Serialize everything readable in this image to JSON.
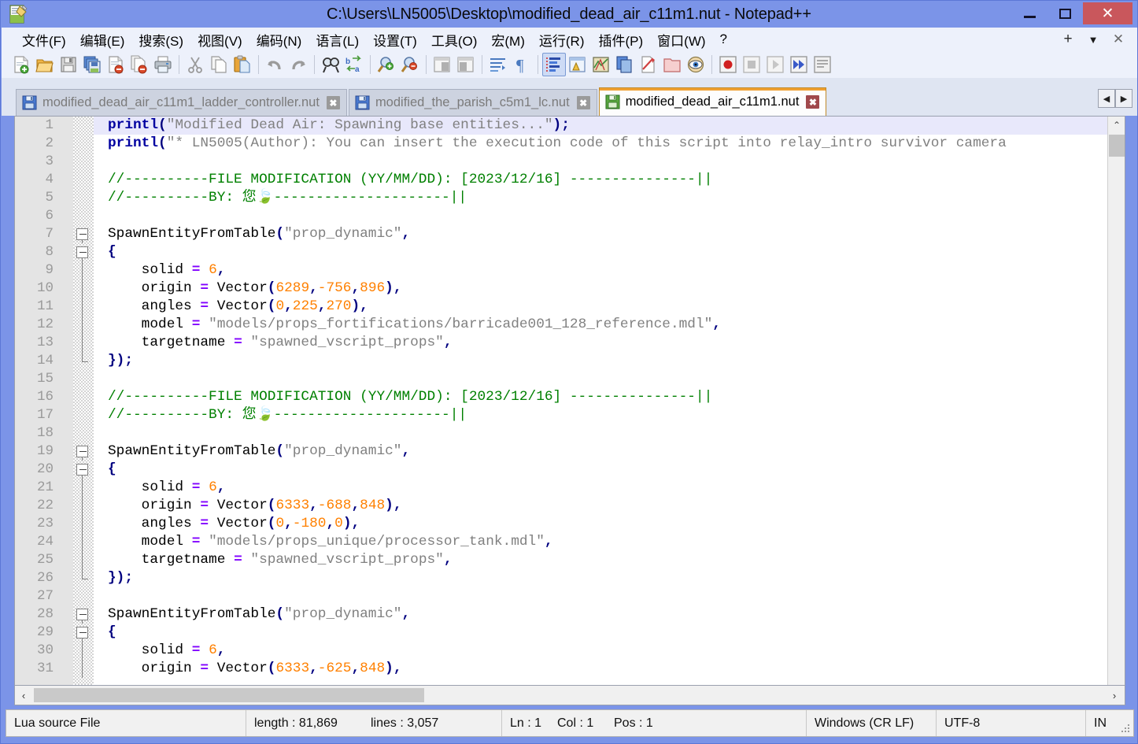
{
  "window": {
    "title": "C:\\Users\\LN5005\\Desktop\\modified_dead_air_c11m1.nut - Notepad++",
    "app_icon": "notepad-plus-plus-icon",
    "minimize_label": "–",
    "maximize_label": "□",
    "close_label": "✕",
    "titlebar_color": "#7b94e8",
    "close_button_color": "#c9575c"
  },
  "menubar": {
    "items": [
      {
        "label": "文件(F)",
        "mnemonic": "F"
      },
      {
        "label": "编辑(E)",
        "mnemonic": "E"
      },
      {
        "label": "搜索(S)",
        "mnemonic": "S"
      },
      {
        "label": "视图(V)",
        "mnemonic": "V"
      },
      {
        "label": "编码(N)",
        "mnemonic": "N"
      },
      {
        "label": "语言(L)",
        "mnemonic": "L"
      },
      {
        "label": "设置(T)",
        "mnemonic": "T"
      },
      {
        "label": "工具(O)",
        "mnemonic": "O"
      },
      {
        "label": "宏(M)",
        "mnemonic": "M"
      },
      {
        "label": "运行(R)",
        "mnemonic": "R"
      },
      {
        "label": "插件(P)",
        "mnemonic": "P"
      },
      {
        "label": "窗口(W)",
        "mnemonic": "W"
      },
      {
        "label": "?",
        "mnemonic": ""
      }
    ],
    "right_buttons": [
      {
        "name": "add-tab-button",
        "label": "+"
      },
      {
        "name": "menu-dropdown-button",
        "label": "▼"
      },
      {
        "name": "menu-close-button",
        "label": "✕"
      }
    ]
  },
  "toolbar": {
    "buttons": [
      {
        "name": "new-file-icon",
        "tip": "新建"
      },
      {
        "name": "open-file-icon",
        "tip": "打开"
      },
      {
        "name": "save-icon",
        "tip": "保存"
      },
      {
        "name": "save-all-icon",
        "tip": "全部保存"
      },
      {
        "name": "close-file-icon",
        "tip": "关闭"
      },
      {
        "name": "close-all-files-icon",
        "tip": "全部关闭"
      },
      {
        "name": "print-icon",
        "tip": "打印"
      },
      {
        "name": "sep"
      },
      {
        "name": "cut-icon",
        "tip": "剪切"
      },
      {
        "name": "copy-icon",
        "tip": "复制"
      },
      {
        "name": "paste-icon",
        "tip": "粘贴"
      },
      {
        "name": "sep"
      },
      {
        "name": "undo-icon",
        "tip": "撤销"
      },
      {
        "name": "redo-icon",
        "tip": "重做"
      },
      {
        "name": "sep"
      },
      {
        "name": "find-icon",
        "tip": "查找"
      },
      {
        "name": "replace-icon",
        "tip": "替换"
      },
      {
        "name": "sep"
      },
      {
        "name": "zoom-in-icon",
        "tip": "放大"
      },
      {
        "name": "zoom-out-icon",
        "tip": "缩小"
      },
      {
        "name": "sep"
      },
      {
        "name": "sync-vertical-scroll-icon",
        "tip": "同步垂直滚动"
      },
      {
        "name": "sync-horizontal-scroll-icon",
        "tip": "同步水平滚动"
      },
      {
        "name": "sep"
      },
      {
        "name": "word-wrap-icon",
        "tip": "自动换行"
      },
      {
        "name": "show-all-chars-icon",
        "tip": "显示所有字符"
      },
      {
        "name": "sep"
      },
      {
        "name": "indent-guide-icon",
        "tip": "显示缩进参考线",
        "active": true
      },
      {
        "name": "user-defined-dialog-icon",
        "tip": "用户自定义语言"
      },
      {
        "name": "document-map-icon",
        "tip": "文档地图"
      },
      {
        "name": "function-list-icon",
        "tip": "函数列表"
      },
      {
        "name": "document-switcher-icon",
        "tip": "文档列表"
      },
      {
        "name": "folder-workspace-icon",
        "tip": "文件夹作为工作区"
      },
      {
        "name": "monitor-icon",
        "tip": "监视文件"
      },
      {
        "name": "sep"
      },
      {
        "name": "record-macro-icon",
        "tip": "开始录制宏"
      },
      {
        "name": "stop-macro-icon",
        "tip": "停止录制宏"
      },
      {
        "name": "play-macro-icon",
        "tip": "播放宏"
      },
      {
        "name": "run-macro-multiple-icon",
        "tip": "多次运行宏"
      },
      {
        "name": "save-macro-icon",
        "tip": "保存当前录制的宏"
      }
    ]
  },
  "tabs": {
    "items": [
      {
        "label": "modified_dead_air_c11m1_ladder_controller.nut",
        "selected": false,
        "close": "✖"
      },
      {
        "label": "modified_the_parish_c5m1_lc.nut",
        "selected": false,
        "close": "✖"
      },
      {
        "label": "modified_dead_air_c11m1.nut",
        "selected": true,
        "close": "✖"
      }
    ],
    "scroll_left": "◀",
    "scroll_right": "▶",
    "active_tab_accent": "#f0a030"
  },
  "editor": {
    "lines": [
      {
        "n": "1",
        "current": true,
        "fold": "none",
        "tokens": [
          {
            "t": "fn",
            "v": "printl"
          },
          {
            "t": "punc",
            "v": "("
          },
          {
            "t": "str",
            "v": "\"Modified Dead Air: Spawning base entities...\""
          },
          {
            "t": "punc",
            "v": ")"
          },
          {
            "t": "punc",
            "v": ";"
          }
        ]
      },
      {
        "n": "2",
        "current": false,
        "fold": "none",
        "tokens": [
          {
            "t": "fn",
            "v": "printl"
          },
          {
            "t": "punc",
            "v": "("
          },
          {
            "t": "str",
            "v": "\"* LN5005(Author): You can insert the execution code of this script into relay_intro survivor camera"
          }
        ]
      },
      {
        "n": "3",
        "current": false,
        "fold": "none",
        "tokens": []
      },
      {
        "n": "4",
        "current": false,
        "fold": "none",
        "tokens": [
          {
            "t": "cmt",
            "v": "//----------FILE MODIFICATION (YY/MM/DD): [2023/12/16] ---------------||"
          }
        ]
      },
      {
        "n": "5",
        "current": false,
        "fold": "none",
        "tokens": [
          {
            "t": "cmt",
            "v": "//----------BY: 您🍃---------------------||"
          }
        ]
      },
      {
        "n": "6",
        "current": false,
        "fold": "none",
        "tokens": []
      },
      {
        "n": "7",
        "current": false,
        "fold": "start",
        "tokens": [
          {
            "t": "id",
            "v": "SpawnEntityFromTable"
          },
          {
            "t": "punc",
            "v": "("
          },
          {
            "t": "str",
            "v": "\"prop_dynamic\""
          },
          {
            "t": "punc",
            "v": ","
          }
        ]
      },
      {
        "n": "8",
        "current": false,
        "fold": "start",
        "tokens": [
          {
            "t": "punc",
            "v": "{"
          }
        ]
      },
      {
        "n": "9",
        "current": false,
        "fold": "line",
        "tokens": [
          {
            "t": "id",
            "v": "    solid "
          },
          {
            "t": "op",
            "v": "="
          },
          {
            "t": "id",
            "v": " "
          },
          {
            "t": "num",
            "v": "6"
          },
          {
            "t": "punc",
            "v": ","
          }
        ]
      },
      {
        "n": "10",
        "current": false,
        "fold": "line",
        "tokens": [
          {
            "t": "id",
            "v": "    origin "
          },
          {
            "t": "op",
            "v": "="
          },
          {
            "t": "id",
            "v": " Vector"
          },
          {
            "t": "punc",
            "v": "("
          },
          {
            "t": "num",
            "v": "6289"
          },
          {
            "t": "punc",
            "v": ","
          },
          {
            "t": "num",
            "v": "-756"
          },
          {
            "t": "punc",
            "v": ","
          },
          {
            "t": "num",
            "v": "896"
          },
          {
            "t": "punc",
            "v": ")"
          },
          {
            "t": "punc",
            "v": ","
          }
        ]
      },
      {
        "n": "11",
        "current": false,
        "fold": "line",
        "tokens": [
          {
            "t": "id",
            "v": "    angles "
          },
          {
            "t": "op",
            "v": "="
          },
          {
            "t": "id",
            "v": " Vector"
          },
          {
            "t": "punc",
            "v": "("
          },
          {
            "t": "num",
            "v": "0"
          },
          {
            "t": "punc",
            "v": ","
          },
          {
            "t": "num",
            "v": "225"
          },
          {
            "t": "punc",
            "v": ","
          },
          {
            "t": "num",
            "v": "270"
          },
          {
            "t": "punc",
            "v": ")"
          },
          {
            "t": "punc",
            "v": ","
          }
        ]
      },
      {
        "n": "12",
        "current": false,
        "fold": "line",
        "tokens": [
          {
            "t": "id",
            "v": "    model "
          },
          {
            "t": "op",
            "v": "="
          },
          {
            "t": "id",
            "v": " "
          },
          {
            "t": "str",
            "v": "\"models/props_fortifications/barricade001_128_reference.mdl\""
          },
          {
            "t": "punc",
            "v": ","
          }
        ]
      },
      {
        "n": "13",
        "current": false,
        "fold": "line",
        "tokens": [
          {
            "t": "id",
            "v": "    targetname "
          },
          {
            "t": "op",
            "v": "="
          },
          {
            "t": "id",
            "v": " "
          },
          {
            "t": "str",
            "v": "\"spawned_vscript_props\""
          },
          {
            "t": "punc",
            "v": ","
          }
        ]
      },
      {
        "n": "14",
        "current": false,
        "fold": "end",
        "tokens": [
          {
            "t": "punc",
            "v": "});"
          }
        ]
      },
      {
        "n": "15",
        "current": false,
        "fold": "none",
        "tokens": []
      },
      {
        "n": "16",
        "current": false,
        "fold": "none",
        "tokens": [
          {
            "t": "cmt",
            "v": "//----------FILE MODIFICATION (YY/MM/DD): [2023/12/16] ---------------||"
          }
        ]
      },
      {
        "n": "17",
        "current": false,
        "fold": "none",
        "tokens": [
          {
            "t": "cmt",
            "v": "//----------BY: 您🍃---------------------||"
          }
        ]
      },
      {
        "n": "18",
        "current": false,
        "fold": "none",
        "tokens": []
      },
      {
        "n": "19",
        "current": false,
        "fold": "start",
        "tokens": [
          {
            "t": "id",
            "v": "SpawnEntityFromTable"
          },
          {
            "t": "punc",
            "v": "("
          },
          {
            "t": "str",
            "v": "\"prop_dynamic\""
          },
          {
            "t": "punc",
            "v": ","
          }
        ]
      },
      {
        "n": "20",
        "current": false,
        "fold": "start",
        "tokens": [
          {
            "t": "punc",
            "v": "{"
          }
        ]
      },
      {
        "n": "21",
        "current": false,
        "fold": "line",
        "tokens": [
          {
            "t": "id",
            "v": "    solid "
          },
          {
            "t": "op",
            "v": "="
          },
          {
            "t": "id",
            "v": " "
          },
          {
            "t": "num",
            "v": "6"
          },
          {
            "t": "punc",
            "v": ","
          }
        ]
      },
      {
        "n": "22",
        "current": false,
        "fold": "line",
        "tokens": [
          {
            "t": "id",
            "v": "    origin "
          },
          {
            "t": "op",
            "v": "="
          },
          {
            "t": "id",
            "v": " Vector"
          },
          {
            "t": "punc",
            "v": "("
          },
          {
            "t": "num",
            "v": "6333"
          },
          {
            "t": "punc",
            "v": ","
          },
          {
            "t": "num",
            "v": "-688"
          },
          {
            "t": "punc",
            "v": ","
          },
          {
            "t": "num",
            "v": "848"
          },
          {
            "t": "punc",
            "v": ")"
          },
          {
            "t": "punc",
            "v": ","
          }
        ]
      },
      {
        "n": "23",
        "current": false,
        "fold": "line",
        "tokens": [
          {
            "t": "id",
            "v": "    angles "
          },
          {
            "t": "op",
            "v": "="
          },
          {
            "t": "id",
            "v": " Vector"
          },
          {
            "t": "punc",
            "v": "("
          },
          {
            "t": "num",
            "v": "0"
          },
          {
            "t": "punc",
            "v": ","
          },
          {
            "t": "num",
            "v": "-180"
          },
          {
            "t": "punc",
            "v": ","
          },
          {
            "t": "num",
            "v": "0"
          },
          {
            "t": "punc",
            "v": ")"
          },
          {
            "t": "punc",
            "v": ","
          }
        ]
      },
      {
        "n": "24",
        "current": false,
        "fold": "line",
        "tokens": [
          {
            "t": "id",
            "v": "    model "
          },
          {
            "t": "op",
            "v": "="
          },
          {
            "t": "id",
            "v": " "
          },
          {
            "t": "str",
            "v": "\"models/props_unique/processor_tank.mdl\""
          },
          {
            "t": "punc",
            "v": ","
          }
        ]
      },
      {
        "n": "25",
        "current": false,
        "fold": "line",
        "tokens": [
          {
            "t": "id",
            "v": "    targetname "
          },
          {
            "t": "op",
            "v": "="
          },
          {
            "t": "id",
            "v": " "
          },
          {
            "t": "str",
            "v": "\"spawned_vscript_props\""
          },
          {
            "t": "punc",
            "v": ","
          }
        ]
      },
      {
        "n": "26",
        "current": false,
        "fold": "end",
        "tokens": [
          {
            "t": "punc",
            "v": "});"
          }
        ]
      },
      {
        "n": "27",
        "current": false,
        "fold": "none",
        "tokens": []
      },
      {
        "n": "28",
        "current": false,
        "fold": "start",
        "tokens": [
          {
            "t": "id",
            "v": "SpawnEntityFromTable"
          },
          {
            "t": "punc",
            "v": "("
          },
          {
            "t": "str",
            "v": "\"prop_dynamic\""
          },
          {
            "t": "punc",
            "v": ","
          }
        ]
      },
      {
        "n": "29",
        "current": false,
        "fold": "start",
        "tokens": [
          {
            "t": "punc",
            "v": "{"
          }
        ]
      },
      {
        "n": "30",
        "current": false,
        "fold": "line",
        "tokens": [
          {
            "t": "id",
            "v": "    solid "
          },
          {
            "t": "op",
            "v": "="
          },
          {
            "t": "id",
            "v": " "
          },
          {
            "t": "num",
            "v": "6"
          },
          {
            "t": "punc",
            "v": ","
          }
        ]
      },
      {
        "n": "31",
        "current": false,
        "fold": "line",
        "tokens": [
          {
            "t": "id",
            "v": "    origin "
          },
          {
            "t": "op",
            "v": "="
          },
          {
            "t": "id",
            "v": " Vector"
          },
          {
            "t": "punc",
            "v": "("
          },
          {
            "t": "num",
            "v": "6333"
          },
          {
            "t": "punc",
            "v": ","
          },
          {
            "t": "num",
            "v": "-625"
          },
          {
            "t": "punc",
            "v": ","
          },
          {
            "t": "num",
            "v": "848"
          },
          {
            "t": "punc",
            "v": ")"
          },
          {
            "t": "punc",
            "v": ","
          }
        ]
      }
    ],
    "colors": {
      "function": "#0000a0",
      "string": "#808080",
      "operator": "#8000ff",
      "punctuation": "#000080",
      "number": "#ff8000",
      "comment": "#008000",
      "current_line_bg": "#e8e8fb",
      "gutter_bg": "#e4e4e4",
      "line_number": "#9a9a9a"
    },
    "scroll": {
      "v_up": "⌃",
      "v_down": "⌄",
      "h_left": "‹",
      "h_right": "›"
    }
  },
  "statusbar": {
    "file_type": "Lua source File",
    "length": "length : 81,869",
    "lines": "lines : 3,057",
    "ln": "Ln : 1",
    "col": "Col : 1",
    "pos": "Pos : 1",
    "eol": "Windows (CR LF)",
    "encoding": "UTF-8",
    "insert_mode": "IN"
  }
}
